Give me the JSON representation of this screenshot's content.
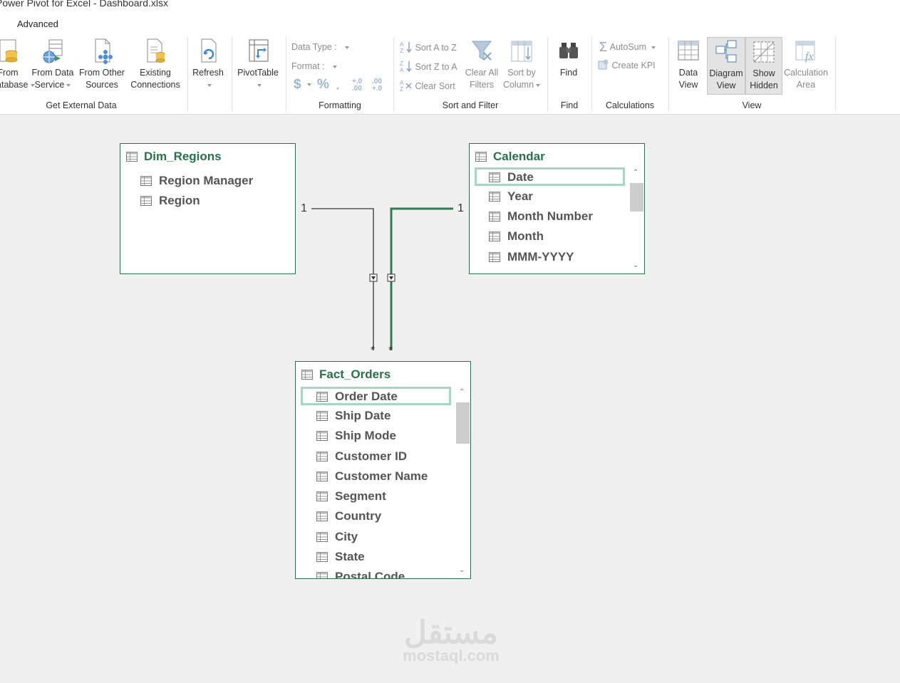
{
  "window": {
    "title": "Power Pivot for Excel - Dashboard.xlsx"
  },
  "tabs": {
    "advanced": "Advanced"
  },
  "ribbon": {
    "get_external_data": {
      "group_label": "Get External Data",
      "from_database": {
        "line1": "From",
        "line2": "Database"
      },
      "from_data_service": {
        "line1": "From Data",
        "line2": "Service"
      },
      "from_other_sources": {
        "line1": "From Other",
        "line2": "Sources"
      },
      "existing_connections": {
        "line1": "Existing",
        "line2": "Connections"
      }
    },
    "refresh": {
      "label": "Refresh"
    },
    "pivottable": {
      "label": "PivotTable"
    },
    "formatting": {
      "group_label": "Formatting",
      "data_type": "Data Type :",
      "format": "Format :",
      "currency_symbol": "$",
      "percent_symbol": "%",
      "comma_symbol": "͙",
      "increase_decimal": "+.0 .00",
      "decrease_decimal": ".00 +.0"
    },
    "sort_filter": {
      "group_label": "Sort and Filter",
      "sort_a_to_z": "Sort A to Z",
      "sort_z_to_a": "Sort Z to A",
      "clear_sort": "Clear Sort",
      "clear_all_filters": {
        "line1": "Clear All",
        "line2": "Filters"
      },
      "sort_by_column": {
        "line1": "Sort by",
        "line2": "Column"
      }
    },
    "find": {
      "group_label": "Find",
      "label": "Find"
    },
    "calculations": {
      "group_label": "Calculations",
      "autosum": "AutoSum",
      "create_kpi": "Create KPI"
    },
    "view": {
      "group_label": "View",
      "data_view": {
        "line1": "Data",
        "line2": "View"
      },
      "diagram_view": {
        "line1": "Diagram",
        "line2": "View"
      },
      "show_hidden": {
        "line1": "Show",
        "line2": "Hidden"
      },
      "calculation_area": {
        "line1": "Calculation",
        "line2": "Area"
      }
    }
  },
  "diagram": {
    "tables": {
      "dim_regions": {
        "name": "Dim_Regions",
        "columns": [
          "Region Manager",
          "Region"
        ]
      },
      "calendar": {
        "name": "Calendar",
        "columns": [
          "Date",
          "Year",
          "Month Number",
          "Month",
          "MMM-YYYY"
        ],
        "selected": "Date"
      },
      "fact_orders": {
        "name": "Fact_Orders",
        "columns": [
          "Order Date",
          "Ship Date",
          "Ship Mode",
          "Customer ID",
          "Customer Name",
          "Segment",
          "Country",
          "City",
          "State",
          "Postal Code"
        ],
        "selected": "Order Date"
      }
    },
    "relationships": {
      "regions_to_orders": {
        "one": "1",
        "many": "*"
      },
      "calendar_to_orders": {
        "one": "1",
        "many": "*"
      }
    }
  },
  "colors": {
    "accent_green": "#27724a",
    "selection_highlight": "#a7d7c1",
    "relationship_line": "#333333",
    "active_relationship": "#2e7d4f"
  },
  "watermark": {
    "arabic": "مستقل",
    "latin": "mostaql.com"
  }
}
